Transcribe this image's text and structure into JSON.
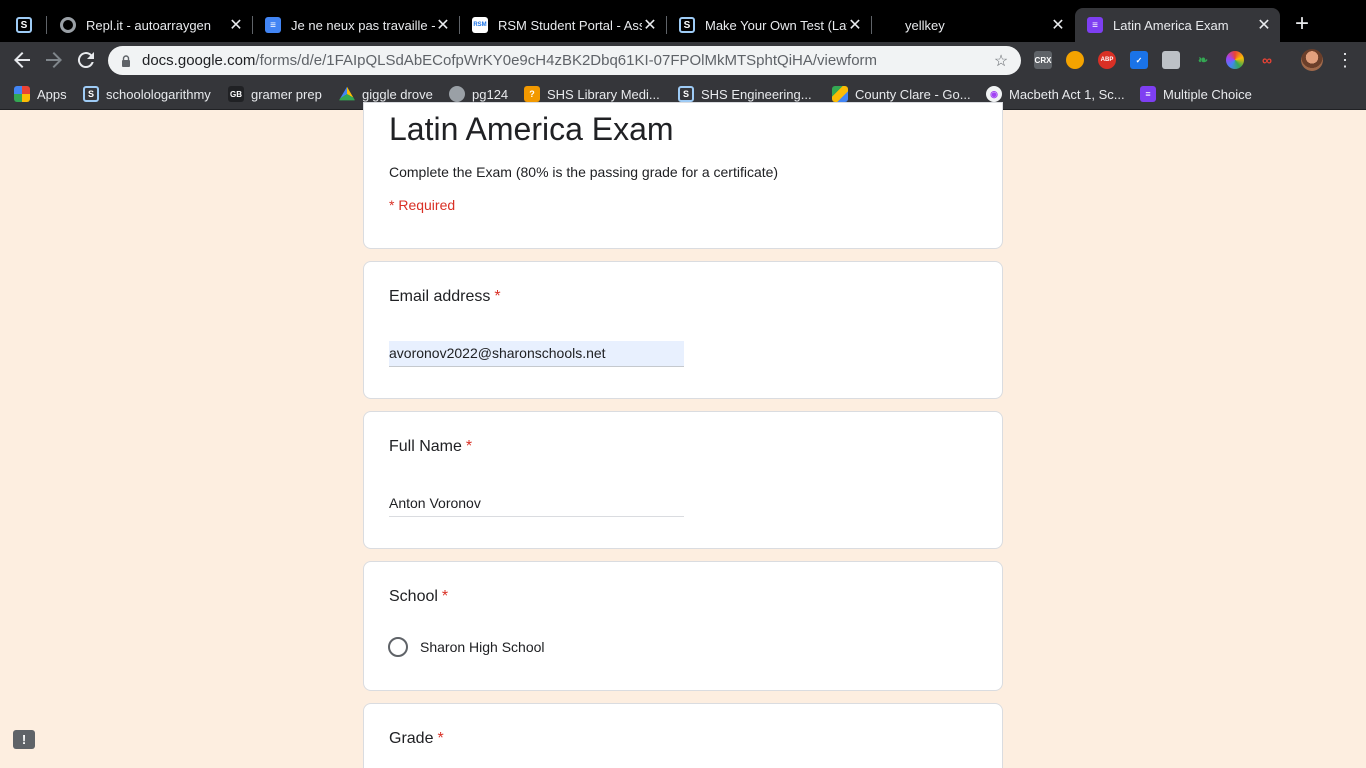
{
  "browser": {
    "tabs": [
      {
        "title": "",
        "icon": "schoology-icon"
      },
      {
        "title": "Repl.it - autoarraygen",
        "icon": "replit-icon"
      },
      {
        "title": "Je ne neux pas travaille -",
        "icon": "google-docs-icon"
      },
      {
        "title": "RSM Student Portal - Ass",
        "icon": "rsm-icon"
      },
      {
        "title": "Make Your Own Test (Lat",
        "icon": "schoology-icon"
      },
      {
        "title": "yellkey",
        "icon": ""
      },
      {
        "title": "Latin America Exam",
        "icon": "google-forms-icon",
        "active": true
      }
    ],
    "new_tab_label": "+",
    "close_glyph": "✕",
    "url_domain": "docs.google.com",
    "url_path": "/forms/d/e/1FAIpQLSdAbECofpWrKY0e9cH4zBK2Dbq61KI-07FPOlMkMTSphtQiHA/viewform",
    "extensions": [
      "CRX",
      "ABP"
    ],
    "bookmarks": [
      {
        "label": "Apps",
        "icon": "apps-grid-icon"
      },
      {
        "label": "schoolologarithmy",
        "icon": "schoology-icon"
      },
      {
        "label": "gramer prep",
        "icon": "gbl-icon"
      },
      {
        "label": "giggle drove",
        "icon": "google-drive-icon"
      },
      {
        "label": "pg124",
        "icon": "globe-icon"
      },
      {
        "label": "SHS Library Medi...",
        "icon": "library-icon"
      },
      {
        "label": "SHS Engineering...",
        "icon": "schoology-icon"
      },
      {
        "label": "County Clare - Go...",
        "icon": "google-maps-icon"
      },
      {
        "label": "Macbeth Act 1, Sc...",
        "icon": "macbeth-icon"
      },
      {
        "label": "Multiple Choice",
        "icon": "google-forms-icon"
      }
    ]
  },
  "form": {
    "title": "Latin America Exam",
    "description": "Complete the Exam (80% is the passing grade for a certificate)",
    "required_note": "* Required",
    "required_marker": "*",
    "questions": {
      "email": {
        "label": "Email address",
        "value": "avoronov2022@sharonschools.net"
      },
      "name": {
        "label": "Full Name",
        "value": "Anton Voronov"
      },
      "school": {
        "label": "School",
        "options": [
          "Sharon High School"
        ]
      },
      "grade": {
        "label": "Grade"
      }
    }
  },
  "feedback_glyph": "!",
  "colors": {
    "page_background": "#fdeee0",
    "required_red": "#d93025",
    "forms_purple": "#7e3ff2",
    "autofill_blue": "#e8f0fe"
  }
}
